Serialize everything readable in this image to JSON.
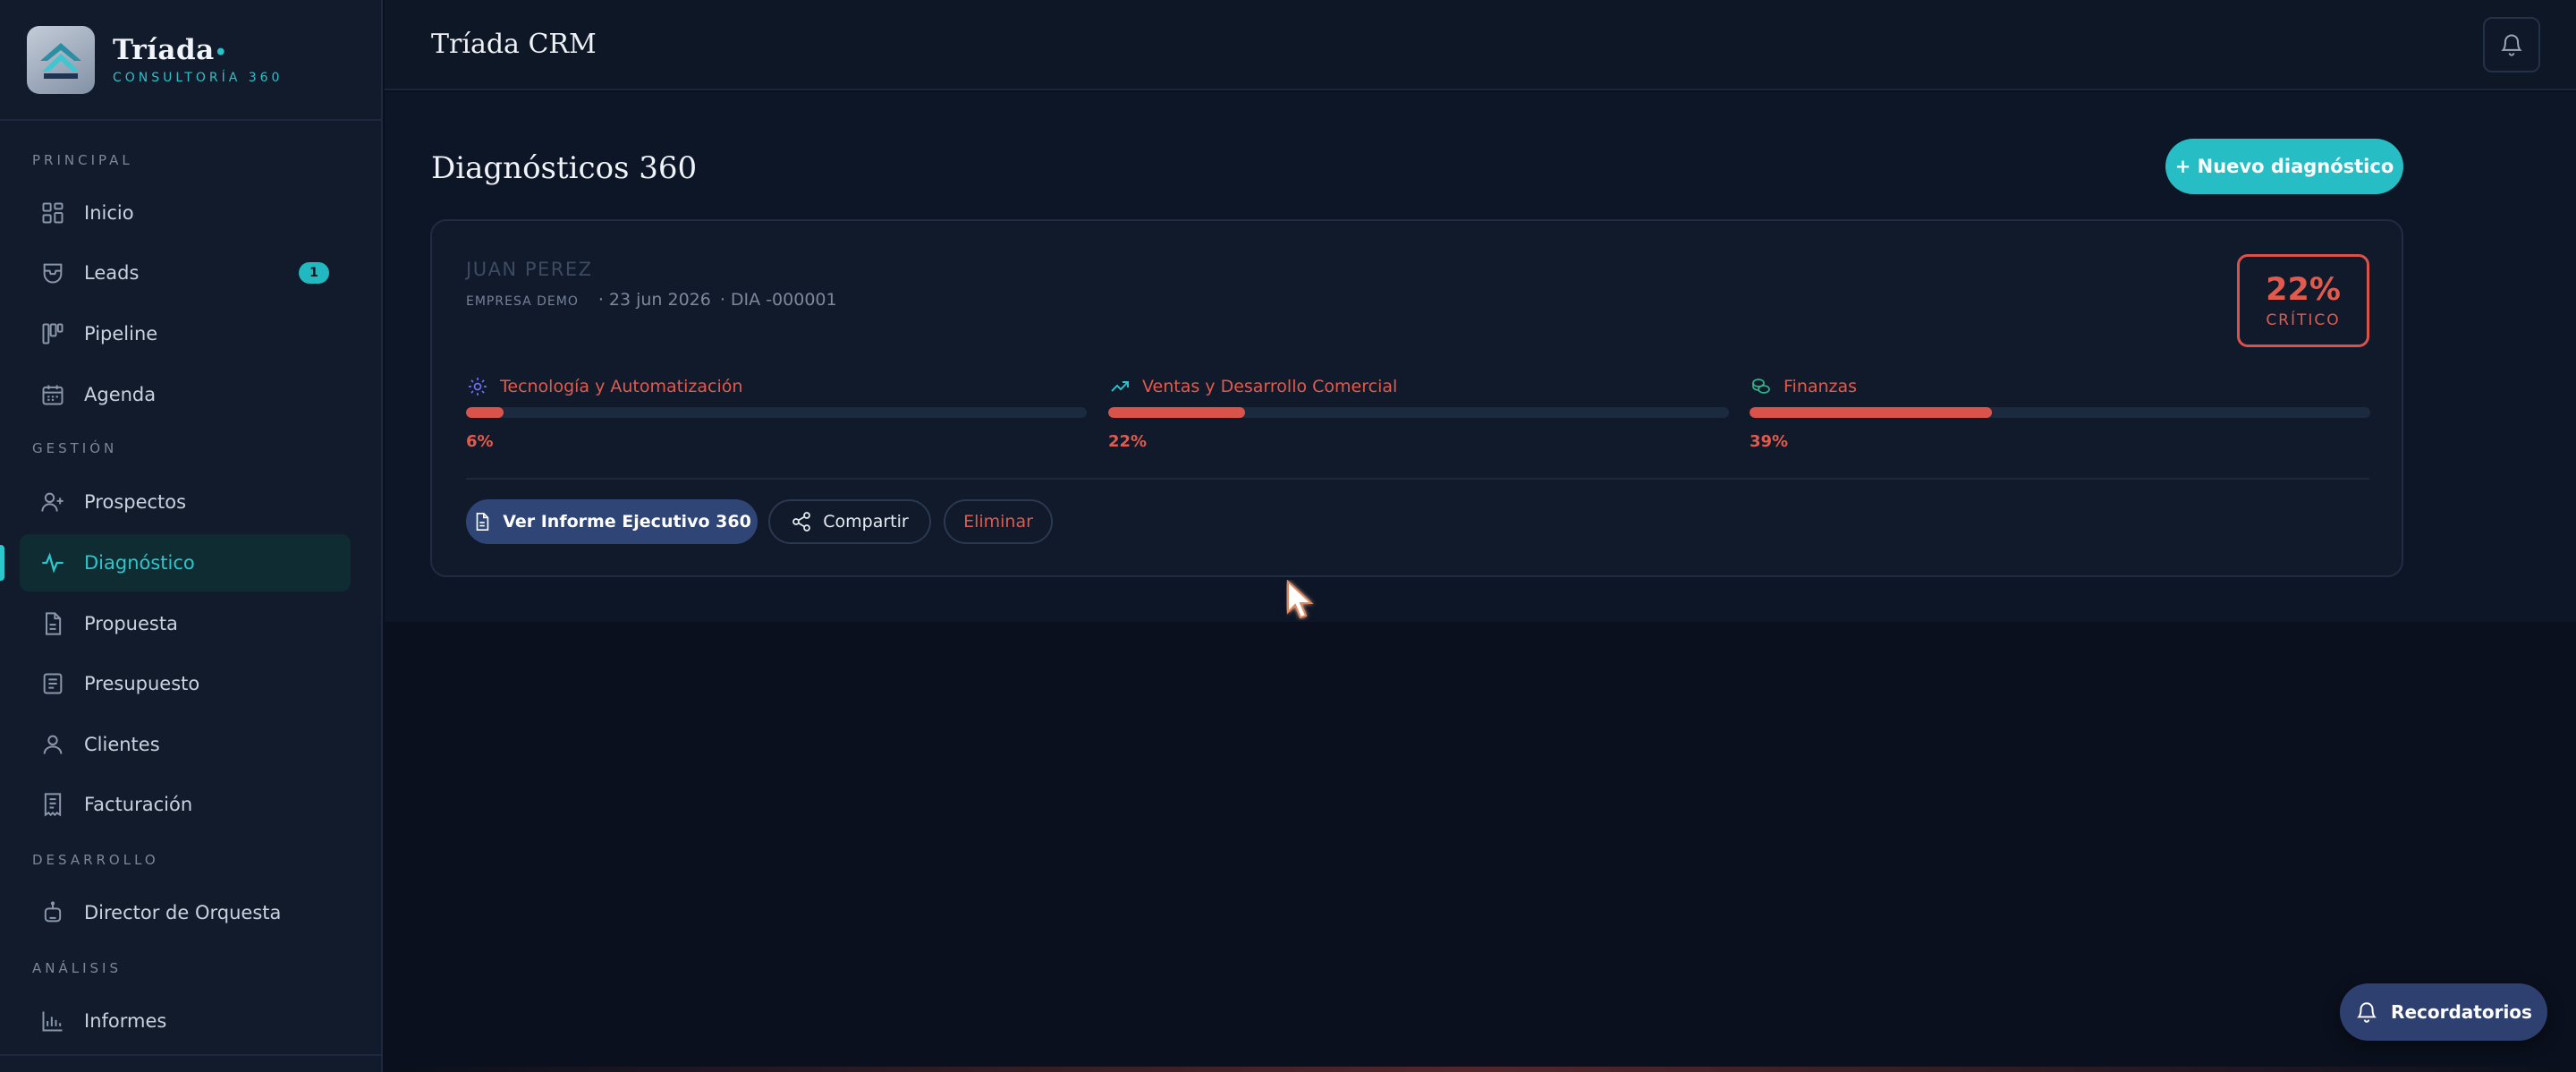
{
  "brand": {
    "name": "Tríada",
    "dot": "•",
    "subtitle": "CONSULTORÍA 360"
  },
  "sidebar": {
    "sections": {
      "principal": "PRINCIPAL",
      "gestion": "GESTIÓN",
      "desarrollo": "DESARROLLO",
      "analisis": "ANÁLISIS"
    },
    "items": [
      {
        "label": "Inicio",
        "icon": "grid-icon"
      },
      {
        "label": "Leads",
        "icon": "inbox-icon",
        "badge": "1"
      },
      {
        "label": "Pipeline",
        "icon": "kanban-icon"
      },
      {
        "label": "Agenda",
        "icon": "calendar-icon"
      },
      {
        "label": "Prospectos",
        "icon": "user-plus-icon"
      },
      {
        "label": "Diagnóstico",
        "icon": "pulse-icon",
        "active": true
      },
      {
        "label": "Propuesta",
        "icon": "document-icon"
      },
      {
        "label": "Presupuesto",
        "icon": "receipt-icon"
      },
      {
        "label": "Clientes",
        "icon": "user-icon"
      },
      {
        "label": "Facturación",
        "icon": "invoice-icon"
      },
      {
        "label": "Director de Orquesta",
        "icon": "robot-icon"
      },
      {
        "label": "Informes",
        "icon": "bar-chart-icon"
      }
    ]
  },
  "topbar": {
    "title": "Tríada CRM"
  },
  "main": {
    "title": "Diagnósticos 360",
    "new_button": "+ Nuevo diagnóstico"
  },
  "card": {
    "client": "JUAN PEREZ",
    "company": "EMPRESA DEMO",
    "date": "23 jun 2026",
    "code": "DIA -000001",
    "score": {
      "value": "22%",
      "label": "CRÍTICO"
    },
    "metrics": [
      {
        "label": "Tecnología y Automatización",
        "value": 6,
        "display": "6%",
        "icon": "gear-icon"
      },
      {
        "label": "Ventas y Desarrollo Comercial",
        "value": 22,
        "display": "22%",
        "icon": "trend-up-icon"
      },
      {
        "label": "Finanzas",
        "value": 39,
        "display": "39%",
        "icon": "coins-icon"
      }
    ],
    "actions": {
      "report": "Ver Informe Ejecutivo 360",
      "share": "Compartir",
      "delete": "Eliminar"
    }
  },
  "reminders": {
    "label": "Recordatorios"
  },
  "colors": {
    "accent": "#27bdc5",
    "critical": "#d9534a",
    "primary_button": "#2e4576"
  }
}
